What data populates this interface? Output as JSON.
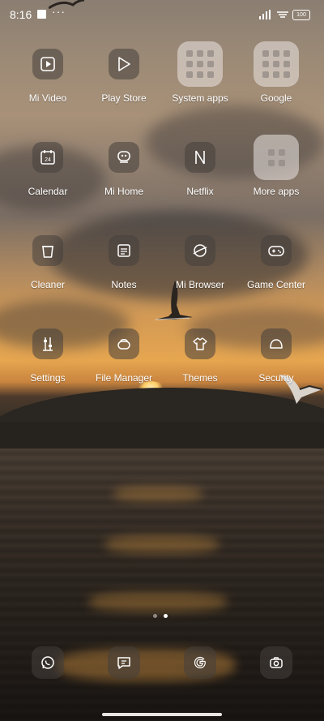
{
  "status_bar": {
    "time": "8:16",
    "more_indicator": "···",
    "battery": "100"
  },
  "apps": [
    {
      "label": "Mi Video",
      "icon": "play-square-icon"
    },
    {
      "label": "Play Store",
      "icon": "play-triangle-icon"
    },
    {
      "label": "System apps",
      "icon": "folder-icon"
    },
    {
      "label": "Google",
      "icon": "folder-icon"
    },
    {
      "label": "Calendar",
      "icon": "calendar-icon",
      "day": "24"
    },
    {
      "label": "Mi Home",
      "icon": "home-robot-icon"
    },
    {
      "label": "Netflix",
      "icon": "netflix-n-icon"
    },
    {
      "label": "More apps",
      "icon": "folder-icon"
    },
    {
      "label": "Cleaner",
      "icon": "trash-icon"
    },
    {
      "label": "Notes",
      "icon": "notes-icon"
    },
    {
      "label": "Mi Browser",
      "icon": "planet-icon"
    },
    {
      "label": "Game Center",
      "icon": "gamepad-icon"
    },
    {
      "label": "Settings",
      "icon": "sliders-icon"
    },
    {
      "label": "File Manager",
      "icon": "folder-pill-icon"
    },
    {
      "label": "Themes",
      "icon": "shirt-icon"
    },
    {
      "label": "Security",
      "icon": "shield-dome-icon"
    }
  ],
  "pager": {
    "pages": 2,
    "current": 2
  },
  "dock": [
    {
      "name": "WhatsApp",
      "icon": "whatsapp-icon"
    },
    {
      "name": "Messages",
      "icon": "message-icon"
    },
    {
      "name": "Google",
      "icon": "google-g-icon"
    },
    {
      "name": "Camera",
      "icon": "camera-icon"
    }
  ]
}
